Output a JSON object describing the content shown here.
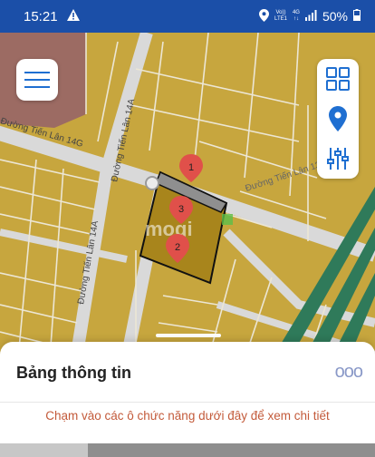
{
  "status_bar": {
    "time": "15:21",
    "network_top": "Vo))",
    "network_bottom": "LTE1",
    "gen_top": "4G",
    "gen_bottom": "↑↓",
    "battery": "50%"
  },
  "map": {
    "street_labels": [
      "Đường Tiến Lân 14A",
      "Đường Tiến Lân 14G",
      "Đường Tiến Lân 13",
      "Đường Tiến Lân 14A"
    ],
    "pins": [
      "1",
      "3",
      "2"
    ],
    "watermark": "mogi"
  },
  "icons": {
    "menu": "menu-icon",
    "grid": "grid-icon",
    "location": "location-pin-icon",
    "filter": "sliders-icon"
  },
  "panel": {
    "title": "Bảng thông tin",
    "more": "ooo",
    "hint": "Chạm vào các ô chức năng dưới đây để xem chi tiết"
  },
  "colors": {
    "status_bar": "#1b4fa8",
    "land": "#c7a63e",
    "selected_lot": "#a8851c",
    "accent": "#1f6fd1",
    "pin": "#e0504a",
    "hint": "#c35a3a"
  }
}
